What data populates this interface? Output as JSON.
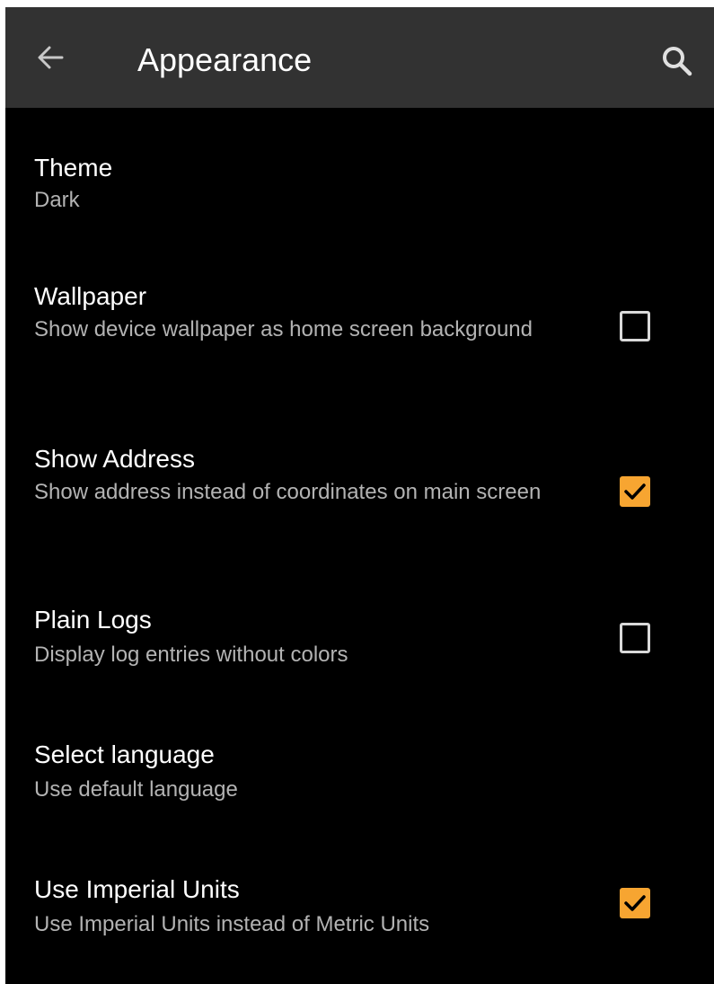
{
  "toolbar": {
    "title": "Appearance",
    "back_icon": "arrow-back-icon",
    "search_icon": "search-icon"
  },
  "colors": {
    "background": "#000000",
    "toolbar": "#323232",
    "accent": "#f7a531",
    "text_primary": "#ffffff",
    "text_secondary": "#b3b3b3"
  },
  "preferences": [
    {
      "title": "Theme",
      "summary": "Dark"
    },
    {
      "title": "Wallpaper",
      "summary": "Show device wallpaper as home screen background",
      "checked": false
    },
    {
      "title": "Show Address",
      "summary": "Show address instead of coordinates on main screen",
      "checked": true
    },
    {
      "title": "Plain Logs",
      "summary": "Display log entries without colors",
      "checked": false
    },
    {
      "title": "Select language",
      "summary": "Use default language"
    },
    {
      "title": "Use Imperial Units",
      "summary": "Use Imperial Units instead of Metric Units",
      "checked": true
    }
  ]
}
